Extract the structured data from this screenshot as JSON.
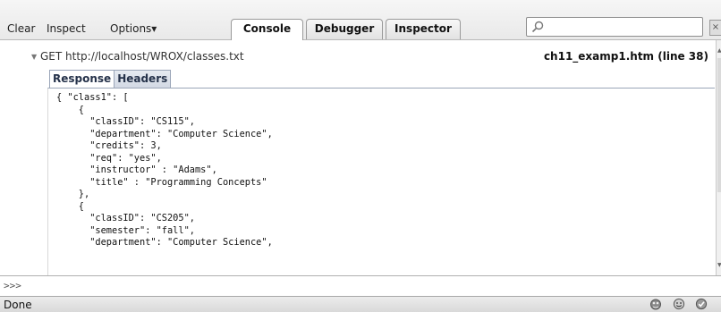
{
  "toolbar": {
    "clear_label": "Clear",
    "inspect_label": "Inspect",
    "options_label": "Options▾",
    "tabs": [
      {
        "label": "Console",
        "active": true
      },
      {
        "label": "Debugger",
        "active": false
      },
      {
        "label": "Inspector",
        "active": false
      }
    ],
    "search": {
      "value": ""
    }
  },
  "console": {
    "request": {
      "text": "GET http://localhost/WROX/classes.txt",
      "source": "ch11_examp1.htm (line 38)"
    },
    "subtabs": [
      {
        "label": "Response",
        "active": true
      },
      {
        "label": "Headers",
        "active": false
      }
    ],
    "response_lines": [
      "{ \"class1\": [",
      "    {",
      "      \"classID\": \"CS115\",",
      "      \"department\": \"Computer Science\",",
      "      \"credits\": 3,",
      "      \"req\": \"yes\",",
      "      \"instructor\" : \"Adams\",",
      "      \"title\" : \"Programming Concepts\"",
      "    },",
      "    {",
      "      \"classID\": \"CS205\",",
      "      \"semester\": \"fall\",",
      "      \"department\": \"Computer Science\","
    ]
  },
  "command_line": {
    "prompt": ">>>",
    "value": ""
  },
  "status_bar": {
    "text": "Done"
  },
  "colors": {
    "accent_tab_border": "#9aa5b8",
    "toolbar_bg": "#efefef"
  }
}
